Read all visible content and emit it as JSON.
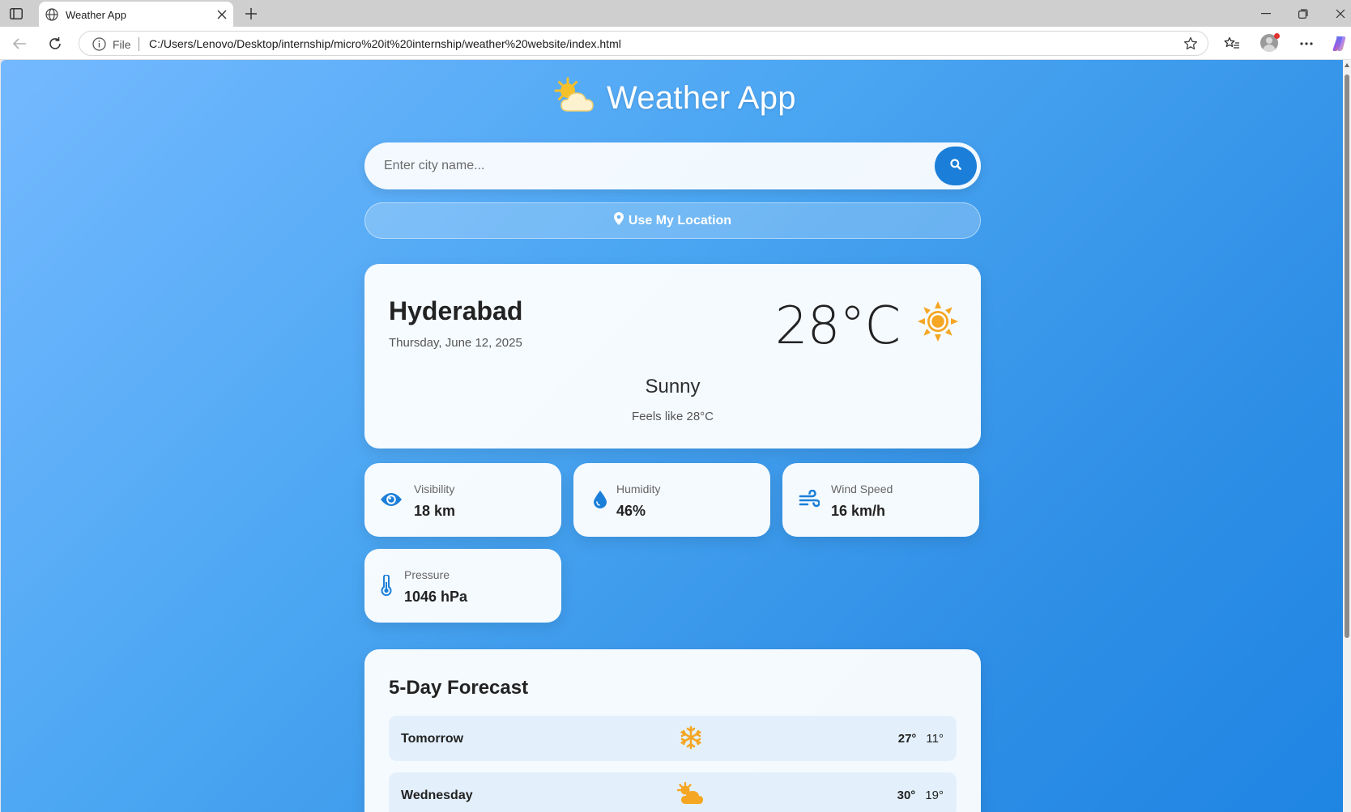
{
  "browser": {
    "tab_title": "Weather App",
    "address_prefix": "File",
    "url": "C:/Users/Lenovo/Desktop/internship/micro%20it%20internship/weather%20website/index.html"
  },
  "app": {
    "title": "Weather App",
    "search_placeholder": "Enter city name...",
    "location_button": "Use My Location"
  },
  "current": {
    "city": "Hyderabad",
    "date": "Thursday, June 12, 2025",
    "temperature": "28°C",
    "condition": "Sunny",
    "feels_like": "Feels like 28°C",
    "icon": "sun-icon"
  },
  "details": [
    {
      "label": "Visibility",
      "value": "18 km",
      "icon": "eye-icon"
    },
    {
      "label": "Humidity",
      "value": "46%",
      "icon": "droplet-icon"
    },
    {
      "label": "Wind Speed",
      "value": "16 km/h",
      "icon": "wind-icon"
    },
    {
      "label": "Pressure",
      "value": "1046 hPa",
      "icon": "thermometer-icon"
    }
  ],
  "forecast": {
    "title": "5-Day Forecast",
    "days": [
      {
        "day": "Tomorrow",
        "high": "27°",
        "low": "11°",
        "icon": "snowflake-icon"
      },
      {
        "day": "Wednesday",
        "high": "30°",
        "low": "19°",
        "icon": "partly-cloudy-icon"
      }
    ]
  },
  "colors": {
    "accent": "#1b7fd9",
    "sun": "#f5a623",
    "bg_start": "#74b9ff",
    "bg_end": "#1f85e3"
  }
}
